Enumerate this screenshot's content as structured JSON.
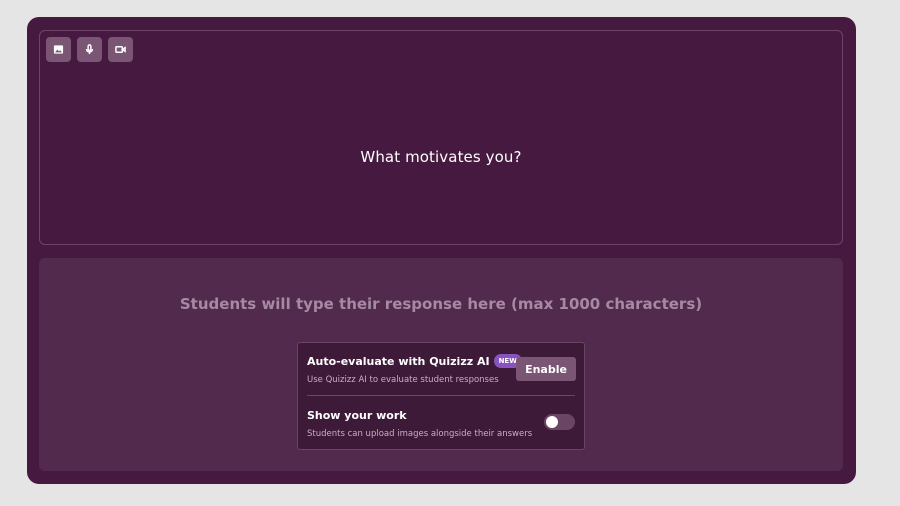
{
  "question": {
    "text": "What motivates you?",
    "media_buttons": [
      {
        "icon": "image-icon"
      },
      {
        "icon": "microphone-icon"
      },
      {
        "icon": "video-icon"
      }
    ]
  },
  "response": {
    "hint": "Students will type their response here (max 1000 characters)"
  },
  "options": {
    "auto_evaluate": {
      "title": "Auto-evaluate with Quizizz AI",
      "badge": "NEW",
      "description": "Use Quizizz AI to evaluate student responses",
      "button_label": "Enable"
    },
    "show_work": {
      "title": "Show your work",
      "description": "Students can upload images alongside their answers",
      "enabled": false
    }
  },
  "colors": {
    "background": "#e5e5e5",
    "card": "#461a40",
    "response_area": "#522a4d",
    "badge": "#8854c0"
  }
}
